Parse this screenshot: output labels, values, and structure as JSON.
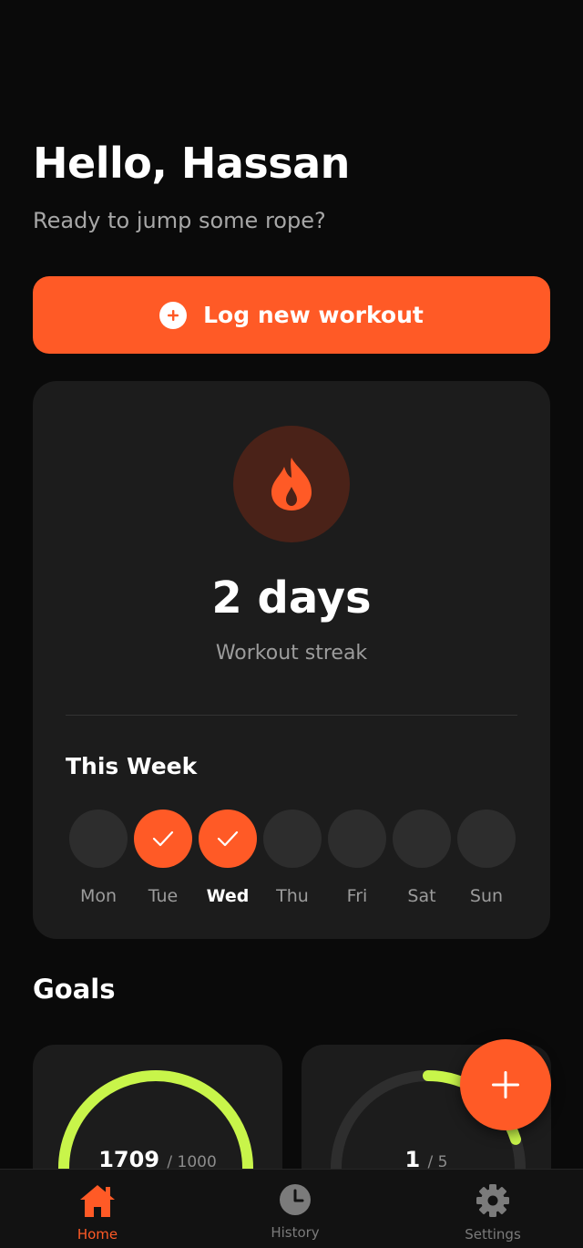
{
  "header": {
    "greeting": "Hello, Hassan",
    "subtitle": "Ready to jump some rope?"
  },
  "log_button": {
    "label": "Log new workout",
    "icon": "plus-circle-icon"
  },
  "streak": {
    "icon": "flame-icon",
    "value": "2 days",
    "label": "Workout streak"
  },
  "week": {
    "title": "This Week",
    "days": [
      {
        "label": "Mon",
        "done": false,
        "today": false
      },
      {
        "label": "Tue",
        "done": true,
        "today": false
      },
      {
        "label": "Wed",
        "done": true,
        "today": true
      },
      {
        "label": "Thu",
        "done": false,
        "today": false
      },
      {
        "label": "Fri",
        "done": false,
        "today": false
      },
      {
        "label": "Sat",
        "done": false,
        "today": false
      },
      {
        "label": "Sun",
        "done": false,
        "today": false
      }
    ]
  },
  "goals": {
    "title": "Goals",
    "items": [
      {
        "current": "1709",
        "target": "/ 1000",
        "progress": 1.0
      },
      {
        "current": "1",
        "target": "/ 5",
        "progress": 0.2
      }
    ]
  },
  "fab": {
    "icon": "plus-icon"
  },
  "nav": {
    "items": [
      {
        "label": "Home",
        "icon": "home-icon",
        "active": true
      },
      {
        "label": "History",
        "icon": "clock-icon",
        "active": false
      },
      {
        "label": "Settings",
        "icon": "gear-icon",
        "active": false
      }
    ]
  },
  "colors": {
    "accent": "#ff5a26",
    "goal_ring": "#c8f54a",
    "card": "#1c1c1c",
    "background": "#0a0a0a"
  }
}
